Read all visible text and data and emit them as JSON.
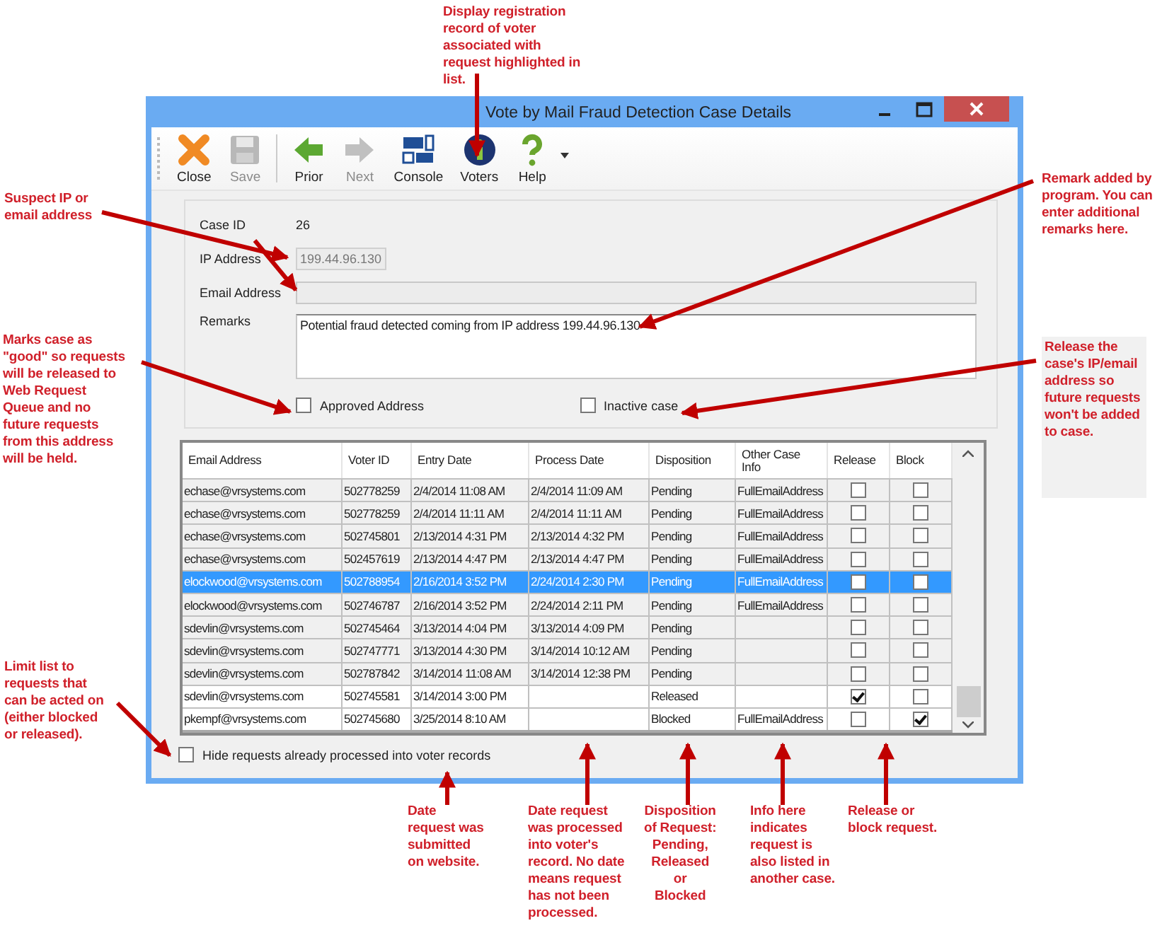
{
  "window": {
    "title": "Vote by Mail Fraud Detection Case Details",
    "toolbar": [
      {
        "kind": "close",
        "label": "Close",
        "disabled": false
      },
      {
        "kind": "save",
        "label": "Save",
        "disabled": true
      },
      {
        "kind": "prior",
        "label": "Prior",
        "disabled": false
      },
      {
        "kind": "next",
        "label": "Next",
        "disabled": true
      },
      {
        "kind": "console",
        "label": "Console",
        "disabled": false
      },
      {
        "kind": "voters",
        "label": "Voters",
        "disabled": false
      },
      {
        "kind": "help",
        "label": "Help",
        "disabled": false
      }
    ],
    "form": {
      "case_id_label": "Case ID",
      "case_id": "26",
      "ip_label": "IP Address",
      "ip_value": "199.44.96.130",
      "email_label": "Email Address",
      "remarks_label": "Remarks",
      "remarks": "Potential fraud detected coming from IP address 199.44.96.130",
      "approved": {
        "label": "Approved Address",
        "checked": false
      },
      "inactive": {
        "label": "Inactive case",
        "checked": false
      }
    },
    "table": {
      "columns": [
        "Email Address",
        "Voter ID",
        "Entry Date",
        "Process Date",
        "Disposition",
        "Other Case Info",
        "Release",
        "Block"
      ],
      "rows": [
        {
          "email": "echase@vrsystems.com",
          "voter_id": "502778259",
          "entry_date": "2/4/2014 11:08 AM",
          "process_date": "2/4/2014 11:09 AM",
          "disposition": "Pending",
          "other": "FullEmailAddress",
          "release": false,
          "block": false,
          "selected": false
        },
        {
          "email": "echase@vrsystems.com",
          "voter_id": "502778259",
          "entry_date": "2/4/2014 11:11 AM",
          "process_date": "2/4/2014 11:11 AM",
          "disposition": "Pending",
          "other": "FullEmailAddress",
          "release": false,
          "block": false,
          "selected": false
        },
        {
          "email": "echase@vrsystems.com",
          "voter_id": "502745801",
          "entry_date": "2/13/2014 4:31 PM",
          "process_date": "2/13/2014 4:32 PM",
          "disposition": "Pending",
          "other": "FullEmailAddress",
          "release": false,
          "block": false,
          "selected": false
        },
        {
          "email": "echase@vrsystems.com",
          "voter_id": "502457619",
          "entry_date": "2/13/2014 4:47 PM",
          "process_date": "2/13/2014 4:47 PM",
          "disposition": "Pending",
          "other": "FullEmailAddress",
          "release": false,
          "block": false,
          "selected": false
        },
        {
          "email": "elockwood@vrsystems.com",
          "voter_id": "502788954",
          "entry_date": "2/16/2014 3:52 PM",
          "process_date": "2/24/2014 2:30 PM",
          "disposition": "Pending",
          "other": "FullEmailAddress",
          "release": false,
          "block": false,
          "selected": true
        },
        {
          "email": "elockwood@vrsystems.com",
          "voter_id": "502746787",
          "entry_date": "2/16/2014 3:52 PM",
          "process_date": "2/24/2014 2:11 PM",
          "disposition": "Pending",
          "other": "FullEmailAddress",
          "release": false,
          "block": false,
          "selected": false
        },
        {
          "email": "sdevlin@vrsystems.com",
          "voter_id": "502745464",
          "entry_date": "3/13/2014 4:04 PM",
          "process_date": "3/13/2014 4:09 PM",
          "disposition": "Pending",
          "release": false,
          "block": false,
          "selected": false
        },
        {
          "email": "sdevlin@vrsystems.com",
          "voter_id": "502747771",
          "entry_date": "3/13/2014 4:30 PM",
          "process_date": "3/14/2014 10:12 AM",
          "disposition": "Pending",
          "release": false,
          "block": false,
          "selected": false
        },
        {
          "email": "sdevlin@vrsystems.com",
          "voter_id": "502787842",
          "entry_date": "3/14/2014 11:08 AM",
          "process_date": "3/14/2014 12:38 PM",
          "disposition": "Pending",
          "release": false,
          "block": false,
          "selected": false
        },
        {
          "email": "sdevlin@vrsystems.com",
          "voter_id": "502745581",
          "entry_date": "3/14/2014 3:00 PM",
          "disposition": "Released",
          "release": true,
          "block": false,
          "selected": false
        },
        {
          "email": "pkempf@vrsystems.com",
          "voter_id": "502745680",
          "entry_date": "3/25/2014 8:10 AM",
          "disposition": "Blocked",
          "other": "FullEmailAddress",
          "release": false,
          "block": true,
          "selected": false
        }
      ]
    },
    "hide_processed": {
      "label": "Hide requests already processed into voter records",
      "checked": false
    }
  },
  "callouts": [
    {
      "text": "Display registration\nrecord of voter\nassociated with\nrequest highlighted in\nlist."
    },
    {
      "text": "Suspect IP or\nemail address"
    },
    {
      "text": "Remark added by\nprogram. You can\nenter additional\nremarks here."
    },
    {
      "text": "Marks case as\n\"good\" so requests\nwill be released to\nWeb Request\nQueue and no\nfuture requests\nfrom this address\nwill be held."
    },
    {
      "text": "Release the\ncase's IP/email\naddress so\nfuture requests\nwon't be added\nto case."
    },
    {
      "text": "Limit list to\nrequests that\ncan be acted on\n(either blocked\nor released)."
    },
    {
      "text": "Date\nrequest was\nsubmitted\non website."
    },
    {
      "text": "Date request\nwas processed\ninto voter's\nrecord. No date\nmeans request\nhas not been\nprocessed."
    },
    {
      "text": "Disposition\nof Request:\nPending,\nReleased\nor\nBlocked"
    },
    {
      "text": "Info here\nindicates\nrequest is\nalso listed in\nanother case."
    },
    {
      "text": "Release or\nblock request."
    }
  ]
}
